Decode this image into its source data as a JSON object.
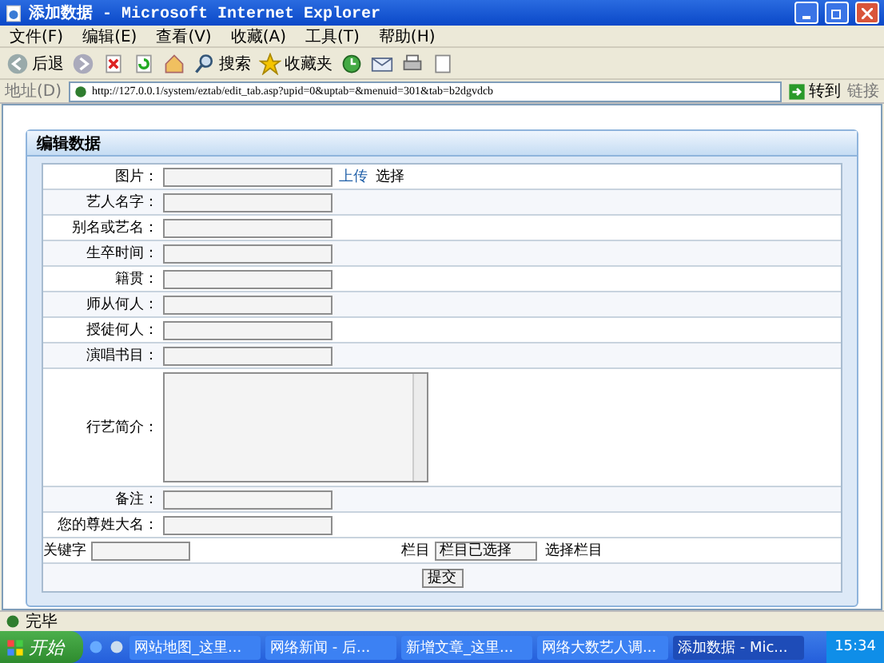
{
  "window": {
    "title": "添加数据 - Microsoft Internet Explorer"
  },
  "menu": [
    "文件(F)",
    "编辑(E)",
    "查看(V)",
    "收藏(A)",
    "工具(T)",
    "帮助(H)"
  ],
  "toolbar": [
    {
      "kind": "back",
      "label": "后退"
    },
    {
      "kind": "forward"
    },
    {
      "kind": "stop"
    },
    {
      "kind": "refresh"
    },
    {
      "kind": "home"
    },
    {
      "kind": "search",
      "label": "搜索"
    },
    {
      "kind": "favorites",
      "label": "收藏夹"
    },
    {
      "kind": "history"
    },
    {
      "kind": "mail"
    },
    {
      "kind": "print"
    },
    {
      "kind": "edit"
    }
  ],
  "address": {
    "label": "地址(D)",
    "url": "http://127.0.0.1/system/eztab/edit_tab.asp?upid=0&uptab=&menuid=301&tab=b2dgvdcb",
    "go": "转到",
    "links": "链接"
  },
  "panel": {
    "title": "编辑数据",
    "fields": [
      {
        "label": "图片：",
        "kind": "text",
        "actions": [
          {
            "kind": "link",
            "label": "上传"
          },
          {
            "kind": "plain",
            "label": "选择"
          }
        ]
      },
      {
        "label": "艺人名字：",
        "kind": "text"
      },
      {
        "label": "别名或艺名：",
        "kind": "text"
      },
      {
        "label": "生卒时间：",
        "kind": "text"
      },
      {
        "label": "籍贯：",
        "kind": "text"
      },
      {
        "label": "师从何人：",
        "kind": "text"
      },
      {
        "label": "授徒何人：",
        "kind": "text"
      },
      {
        "label": "演唱书目：",
        "kind": "text"
      },
      {
        "label": "行艺简介：",
        "kind": "textarea"
      },
      {
        "label": "备注：",
        "kind": "text"
      },
      {
        "label": "您的尊姓大名：",
        "kind": "text"
      }
    ],
    "keyword": {
      "label": "关键字"
    },
    "column": {
      "label": "栏目",
      "value": "栏目已选择",
      "action": "选择栏目"
    },
    "submit": "提交"
  },
  "status_bar": {
    "text": "完毕"
  },
  "taskbar": {
    "start": "开始",
    "tasks": [
      {
        "label": "网站地图_这里...",
        "selected": false
      },
      {
        "label": "网络新闻 - 后...",
        "selected": false
      },
      {
        "label": "新增文章_这里...",
        "selected": false
      },
      {
        "label": "网络大数艺人调...",
        "selected": false
      },
      {
        "label": "添加数据 - Mic...",
        "selected": true
      }
    ],
    "clock": "15:34"
  }
}
